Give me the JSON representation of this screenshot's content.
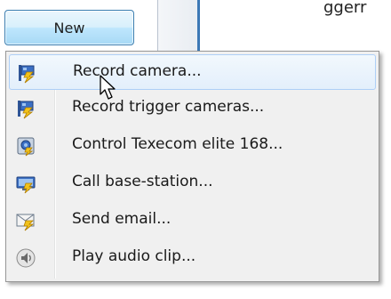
{
  "new_button": {
    "label": "New"
  },
  "background": {
    "partial_text": "ggerr"
  },
  "menu": {
    "items": [
      {
        "label": "Record camera...",
        "icon": "camera-record-icon",
        "hovered": true
      },
      {
        "label": "Record trigger cameras...",
        "icon": "trigger-cameras-icon",
        "hovered": false
      },
      {
        "label": "Control Texecom elite 168...",
        "icon": "alarm-panel-icon",
        "hovered": false
      },
      {
        "label": "Call base-station...",
        "icon": "base-station-icon",
        "hovered": false
      },
      {
        "label": "Send email...",
        "icon": "email-icon",
        "hovered": false
      },
      {
        "label": "Play audio clip...",
        "icon": "speaker-icon",
        "hovered": false
      }
    ]
  },
  "colors": {
    "button_border": "#3c7fb1",
    "menu_background": "#f0f0f0",
    "hover_border": "#aecff7",
    "icon_blue": "#3b6fc4",
    "icon_yellow": "#f2c21a"
  }
}
